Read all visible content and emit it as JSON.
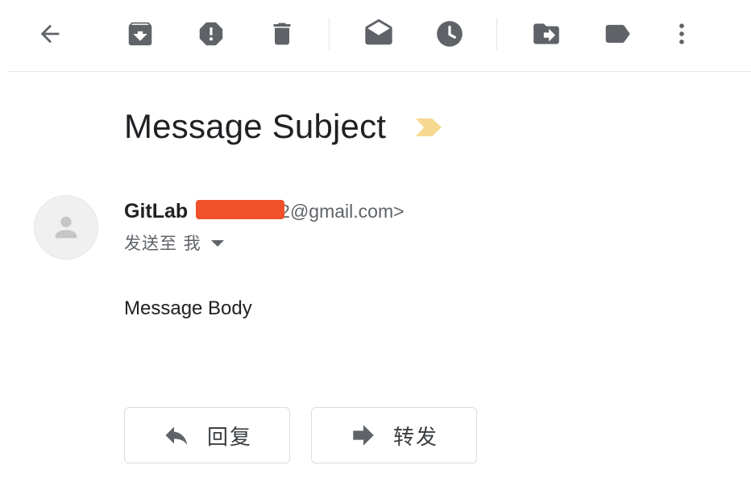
{
  "toolbar": {
    "icons": {
      "back": "arrow-back-icon",
      "archive": "archive-icon",
      "spam": "report-spam-icon",
      "delete": "trash-icon",
      "mark_unread": "mark-unread-icon",
      "snooze": "clock-icon",
      "move": "move-to-icon",
      "label": "label-icon",
      "more": "more-vert-icon"
    },
    "icon_color": "#5f6368"
  },
  "message": {
    "subject": "Message Subject",
    "importance_color": "#f6d88f",
    "sender": {
      "name": "GitLab",
      "email_visible_tail": "2@gmail.com>",
      "redaction_color": "#f0512a"
    },
    "recipient": {
      "text": "发送至 我"
    },
    "body": "Message Body"
  },
  "actions": {
    "reply_label": "回复",
    "forward_label": "转发"
  }
}
